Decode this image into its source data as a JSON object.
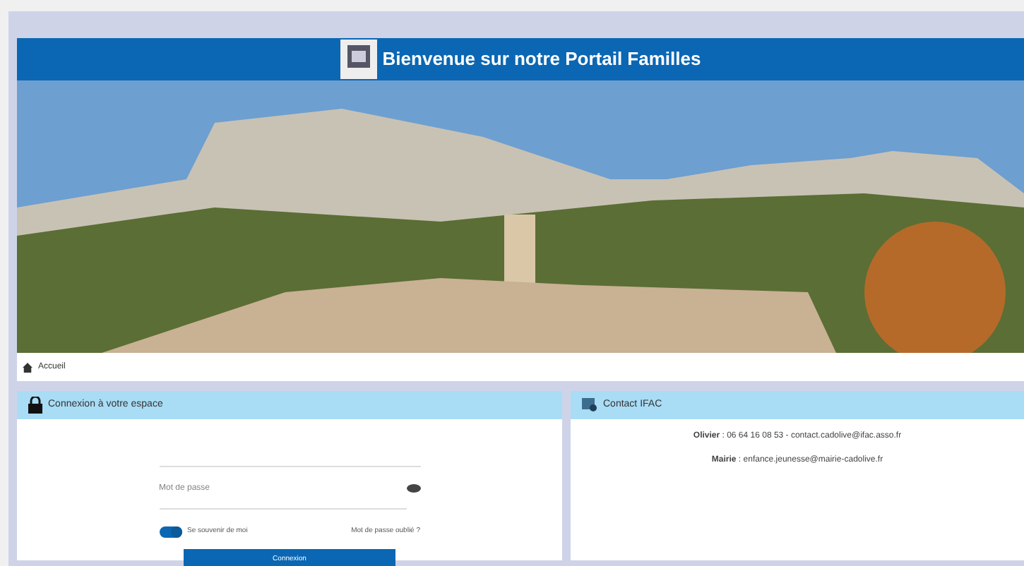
{
  "header": {
    "title": "Bienvenue sur notre Portail Familles"
  },
  "breadcrumb": {
    "label": "Accueil"
  },
  "login": {
    "title": "Connexion à votre espace",
    "password": {
      "placeholder": "Mot de passe"
    },
    "remember": {
      "label": "Se souvenir de moi",
      "on": true
    },
    "forgot": "Mot de passe oublié ?",
    "submit": "Connexion"
  },
  "contact": {
    "title": "Contact IFAC",
    "lines": [
      {
        "name": "Olivier",
        "text": " : 06 64 16 08 53 - contact.cadolive@ifac.asso.fr"
      },
      {
        "name": "Mairie",
        "text": " : enfance.jeunesse@mairie-cadolive.fr"
      }
    ]
  }
}
